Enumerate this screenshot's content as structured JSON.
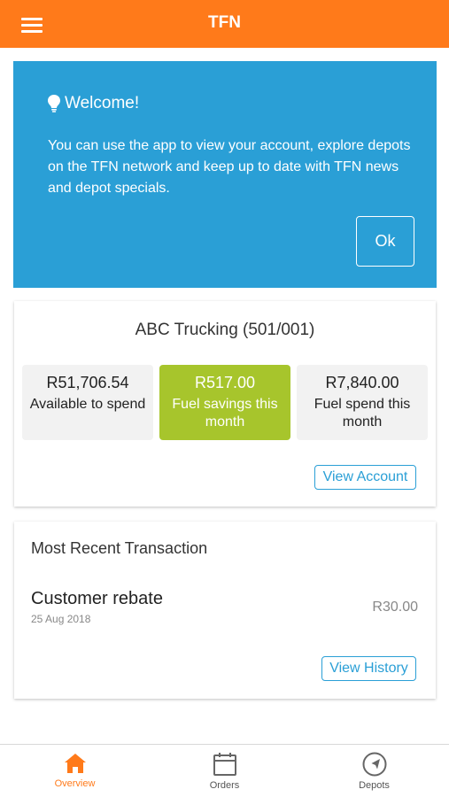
{
  "header": {
    "title": "TFN"
  },
  "welcome": {
    "title": "Welcome!",
    "body": "You can use the app to view your account, explore depots on the TFN network and keep up to date with TFN news and depot specials.",
    "ok_label": "Ok"
  },
  "account": {
    "name": "ABC Trucking (501/001)",
    "stats": [
      {
        "value": "R51,706.54",
        "label": "Available to spend"
      },
      {
        "value": "R517.00",
        "label": "Fuel savings this month"
      },
      {
        "value": "R7,840.00",
        "label": "Fuel spend this month"
      }
    ],
    "view_account_label": "View Account"
  },
  "transaction": {
    "heading": "Most Recent Transaction",
    "title": "Customer rebate",
    "date": "25 Aug 2018",
    "amount": "R30.00",
    "view_history_label": "View History"
  },
  "nav": {
    "items": [
      {
        "label": "Overview",
        "icon": "home-icon",
        "active": true
      },
      {
        "label": "Orders",
        "icon": "calendar-icon",
        "active": false
      },
      {
        "label": "Depots",
        "icon": "compass-icon",
        "active": false
      }
    ]
  },
  "colors": {
    "primary": "#ff7a1a",
    "welcome_bg": "#2a9fd6",
    "savings_bg": "#a7c52c",
    "link": "#2a9fd6"
  }
}
